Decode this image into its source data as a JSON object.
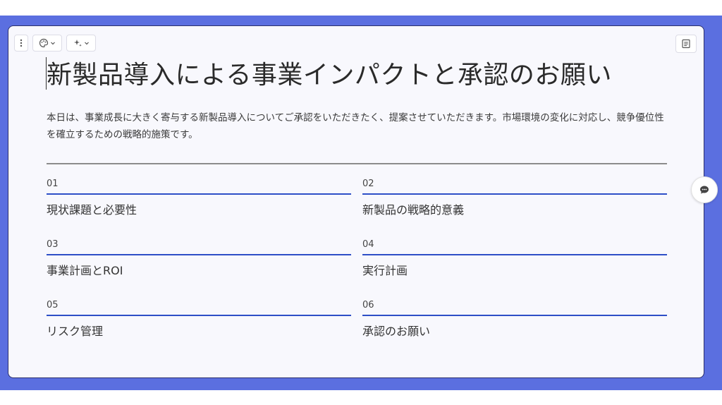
{
  "slide": {
    "title": "新製品導入による事業インパクトと承認のお願い",
    "intro": "本日は、事業成長に大きく寄与する新製品導入についてご承認をいただきたく、提案させていただきます。市場環境の変化に対応し、競争優位性を確立するための戦略的施策です。",
    "agenda": [
      {
        "num": "01",
        "label": "現状課題と必要性"
      },
      {
        "num": "02",
        "label": "新製品の戦略的意義"
      },
      {
        "num": "03",
        "label": "事業計画とROI"
      },
      {
        "num": "04",
        "label": "実行計画"
      },
      {
        "num": "05",
        "label": "リスク管理"
      },
      {
        "num": "06",
        "label": "承認のお願い"
      }
    ]
  },
  "toolbar": {
    "menu_icon": "more-vertical-icon",
    "theme_icon": "palette-icon",
    "ai_icon": "sparkle-icon",
    "notes_icon": "notes-icon"
  },
  "colors": {
    "frame": "#5b6fe0",
    "accent_line": "#2e4fc7",
    "card": "#f8f8fd"
  }
}
